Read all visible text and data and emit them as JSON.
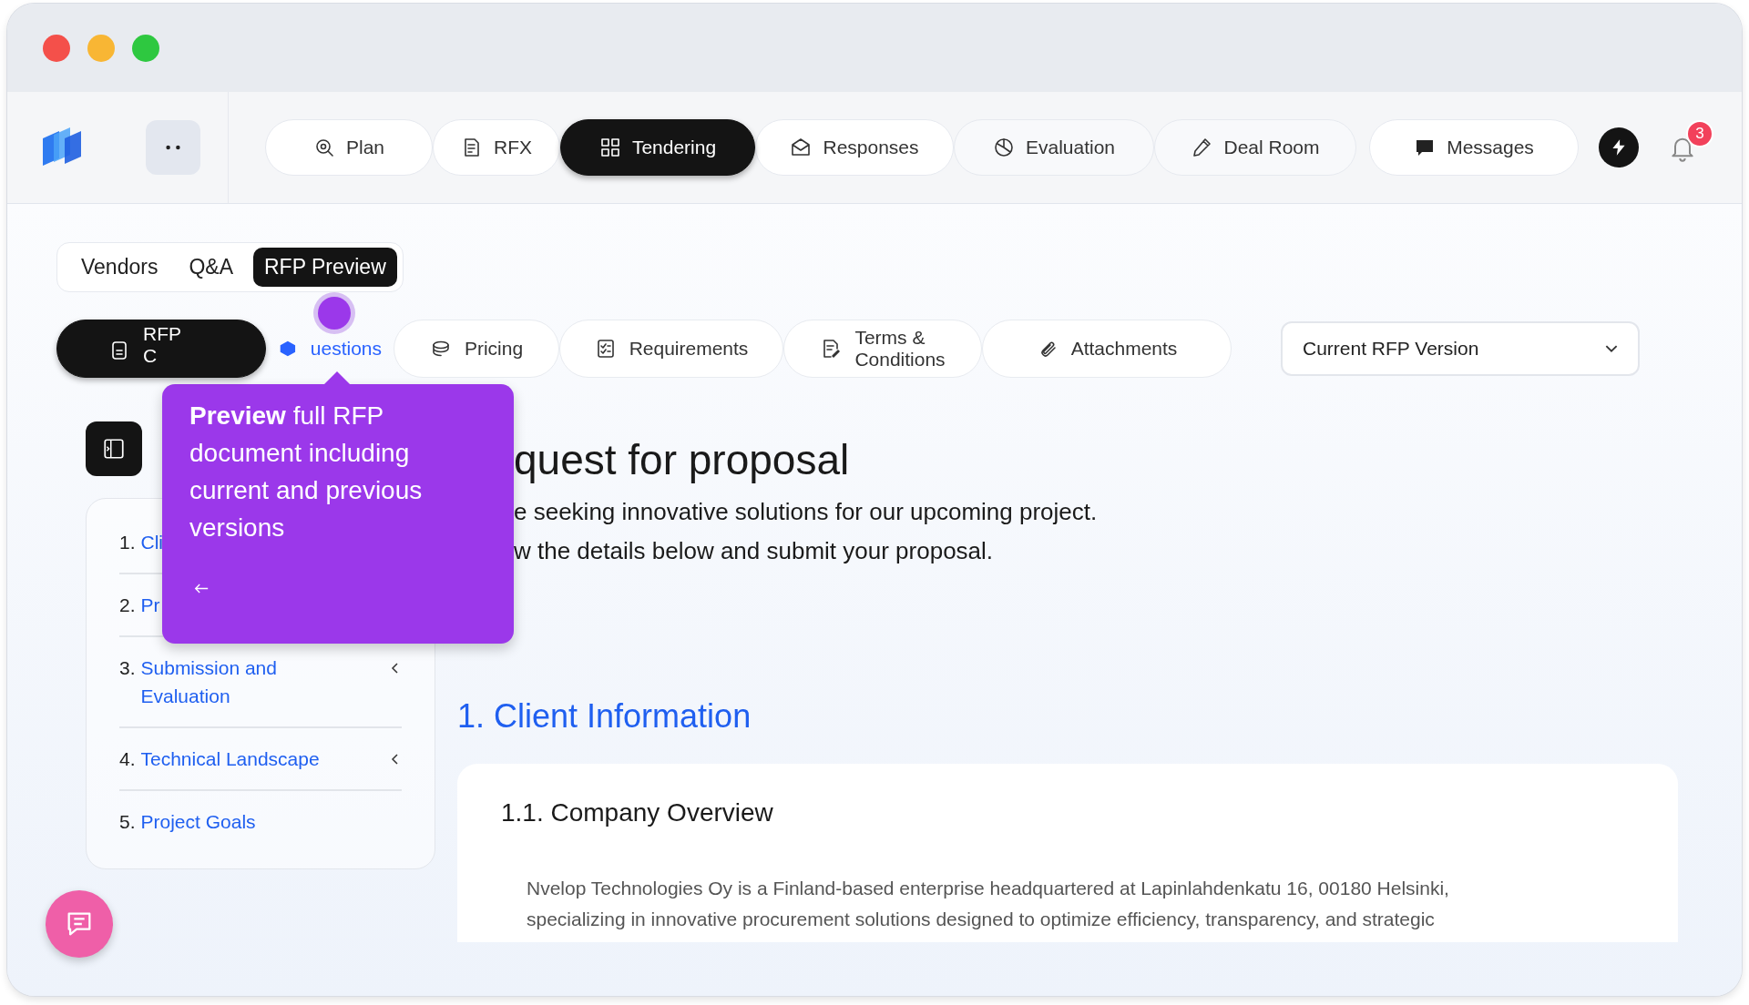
{
  "nav": {
    "items": [
      {
        "label": "Plan",
        "selected": false
      },
      {
        "label": "RFX",
        "selected": false
      },
      {
        "label": "Tendering",
        "selected": true
      },
      {
        "label": "Responses",
        "selected": false
      },
      {
        "label": "Evaluation",
        "selected": false
      },
      {
        "label": "Deal Room",
        "selected": false
      }
    ],
    "messages": "Messages",
    "notifications": "3"
  },
  "view_tabs": [
    {
      "label": "Vendors",
      "selected": false
    },
    {
      "label": "Q&A",
      "selected": false
    },
    {
      "label": "RFP Preview",
      "selected": true
    }
  ],
  "section_tabs": [
    {
      "lines": [
        "RFP",
        "C"
      ],
      "selected": true
    },
    {
      "lines": [
        "uestions"
      ],
      "selected": false
    },
    {
      "lines": [
        "Pricing"
      ],
      "selected": false
    },
    {
      "lines": [
        "Requirements"
      ],
      "selected": false
    },
    {
      "lines": [
        "Terms &",
        "Conditions"
      ],
      "selected": false
    },
    {
      "lines": [
        "Attachments"
      ],
      "selected": false
    }
  ],
  "version_select": {
    "value": "Current RFP Version"
  },
  "toc": [
    {
      "number": "1.",
      "title": "Cli"
    },
    {
      "number": "2.",
      "title": "Pr"
    },
    {
      "number": "3.",
      "title": "Submission and Evaluation",
      "expandable": true
    },
    {
      "number": "4.",
      "title": "Technical Landscape",
      "expandable": true
    },
    {
      "number": "5.",
      "title": "Project Goals",
      "expandable": false
    }
  ],
  "document": {
    "title": "quest for proposal",
    "intro": [
      "e seeking innovative solutions for our upcoming project.",
      "w the details below and submit your proposal."
    ],
    "section_title": "1. Client Information",
    "subsection_title": "1.1. Company Overview",
    "paragraph": "Nvelop Technologies Oy is a Finland-based enterprise headquartered at Lapinlahdenkatu 16, 00180 Helsinki, specializing in innovative procurement solutions designed to optimize efficiency, transparency, and strategic"
  },
  "tooltip": {
    "text": "**Preview** full RFP document including current and previous versions"
  }
}
